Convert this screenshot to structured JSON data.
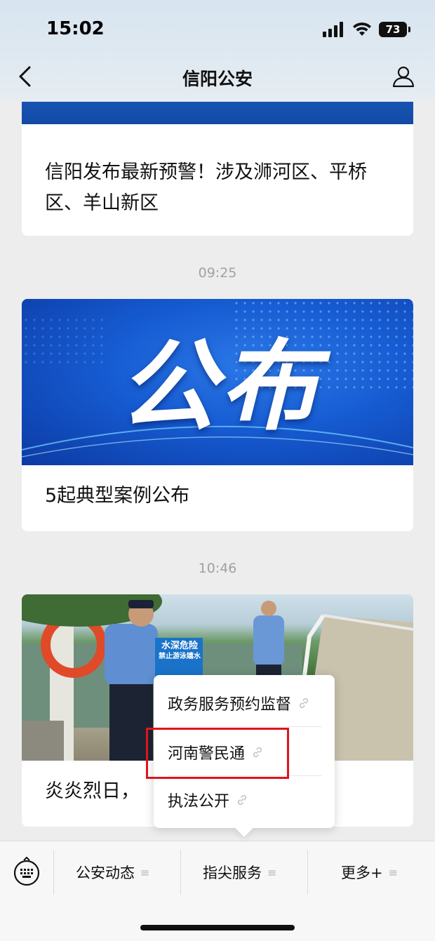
{
  "status": {
    "time": "15:02",
    "battery": "73"
  },
  "nav": {
    "title": "信阳公安"
  },
  "articles": [
    {
      "title": "信阳发布最新预警！涉及浉河区、平桥区、羊山新区"
    },
    {
      "time": "09:25",
      "banner_text": "公布",
      "title": "5起典型案例公布"
    },
    {
      "time": "10:46",
      "title": "炎炎烈日，",
      "sign_text_1": "水深危险",
      "sign_text_2": "禁止游泳嬉水"
    }
  ],
  "popup_menu": {
    "items": [
      {
        "label": "政务服务预约监督"
      },
      {
        "label": "河南警民通"
      },
      {
        "label": "执法公开"
      }
    ],
    "highlight_color": "#e0141d"
  },
  "bottom_menu": {
    "items": [
      {
        "label": "公安动态"
      },
      {
        "label": "指尖服务"
      },
      {
        "label": "更多+"
      }
    ]
  },
  "colors": {
    "background": "#ededed",
    "banner_blue": "#165bd2"
  }
}
